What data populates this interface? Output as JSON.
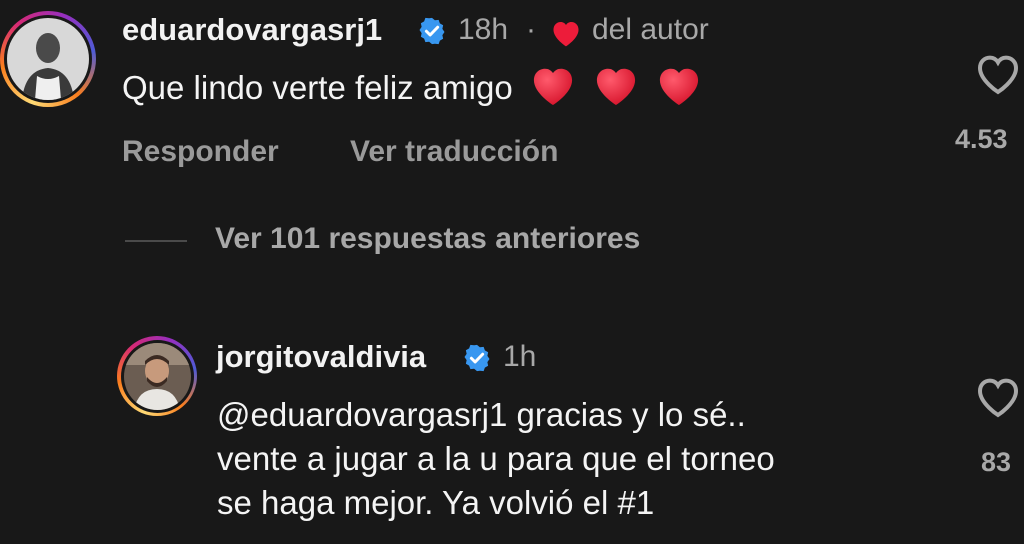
{
  "comment_1": {
    "username": "eduardovargasrj1",
    "time": "18h",
    "separator": "·",
    "author_liked_label": "del autor",
    "text": "Que lindo verte feliz amigo",
    "reply_label": "Responder",
    "translate_label": "Ver traducción",
    "like_count": "4.53"
  },
  "view_replies": {
    "label": "Ver 101 respuestas anteriores"
  },
  "comment_2": {
    "username": "jorgitovaldivia",
    "time": "1h",
    "text_line_1": "@eduardovargasrj1 gracias y lo sé..",
    "text_line_2": "vente a jugar a la u para que el torneo",
    "text_line_3": "se haga mejor. Ya volvió el #1",
    "like_count": "83"
  },
  "colors": {
    "background": "#181818",
    "verified": "#3897f0",
    "heart": "#ed1c3a",
    "secondary_text": "#a8a8a8"
  }
}
